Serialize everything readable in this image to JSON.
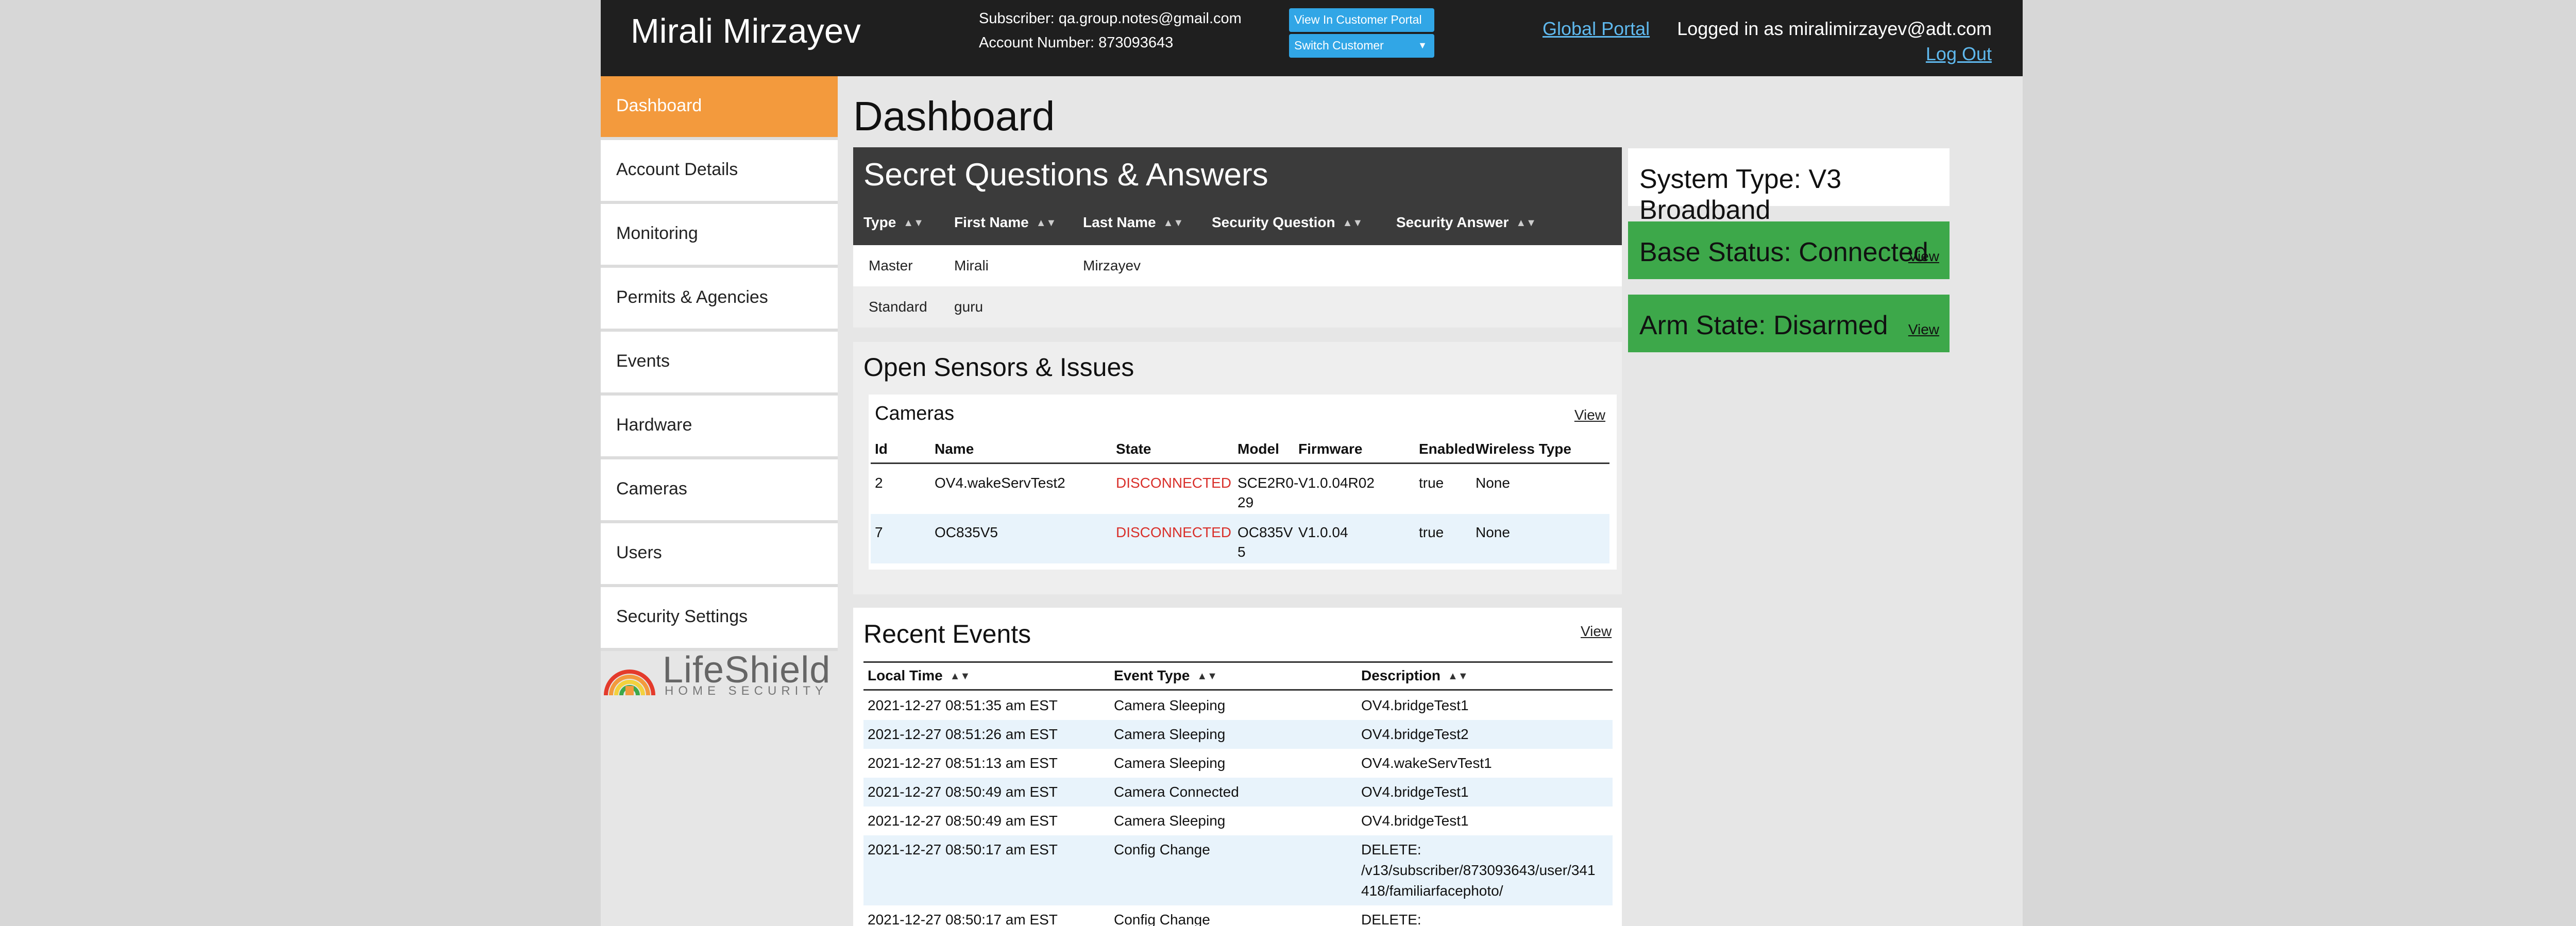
{
  "header": {
    "title": "Mirali Mirzayev",
    "subscriber": "Subscriber: qa.group.notes@gmail.com",
    "account": "Account Number: 873093643",
    "view_portal_btn": "View In Customer Portal",
    "switch_customer_btn": "Switch Customer",
    "global_portal": "Global Portal",
    "logged_in": "Logged in as miralimirzayev@adt.com",
    "logout": "Log Out"
  },
  "sidebar": {
    "items": [
      {
        "label": "Dashboard",
        "active": true
      },
      {
        "label": "Account Details"
      },
      {
        "label": "Monitoring"
      },
      {
        "label": "Permits & Agencies"
      },
      {
        "label": "Events"
      },
      {
        "label": "Hardware"
      },
      {
        "label": "Cameras"
      },
      {
        "label": "Users"
      },
      {
        "label": "Security Settings"
      }
    ],
    "logo_main": "LifeShield",
    "logo_sub": "HOME SECURITY"
  },
  "page": {
    "title": "Dashboard"
  },
  "secret_qa": {
    "title": "Secret Questions & Answers",
    "columns": [
      "Type",
      "First Name",
      "Last Name",
      "Security Question",
      "Security Answer"
    ],
    "rows": [
      [
        "Master",
        "Mirali",
        "Mirzayev",
        "",
        ""
      ],
      [
        "Standard",
        "guru",
        "",
        "",
        ""
      ]
    ]
  },
  "sensors": {
    "title": "Open Sensors & Issues",
    "cameras_title": "Cameras",
    "view": "View",
    "columns": [
      "Id",
      "Name",
      "State",
      "Model",
      "Firmware",
      "Enabled",
      "Wireless Type"
    ],
    "rows": [
      {
        "id": "2",
        "name": "OV4.wakeServTest2",
        "state": "DISCONNECTED",
        "model_1": "SCE2R0-",
        "model_2": "29",
        "firmware": "V1.0.04R02",
        "enabled": "true",
        "wireless": "None"
      },
      {
        "id": "7",
        "name": "OC835V5",
        "state": "DISCONNECTED",
        "model_1": "OC835V",
        "model_2": "5",
        "firmware": "V1.0.04",
        "enabled": "true",
        "wireless": "None"
      }
    ]
  },
  "events": {
    "title": "Recent Events",
    "view": "View",
    "columns": [
      "Local Time",
      "Event Type",
      "Description"
    ],
    "rows": [
      {
        "time": "2021-12-27 08:51:35 am EST",
        "type": "Camera Sleeping",
        "desc": "OV4.bridgeTest1"
      },
      {
        "time": "2021-12-27 08:51:26 am EST",
        "type": "Camera Sleeping",
        "desc": "OV4.bridgeTest2"
      },
      {
        "time": "2021-12-27 08:51:13 am EST",
        "type": "Camera Sleeping",
        "desc": "OV4.wakeServTest1"
      },
      {
        "time": "2021-12-27 08:50:49 am EST",
        "type": "Camera Connected",
        "desc": "OV4.bridgeTest1"
      },
      {
        "time": "2021-12-27 08:50:49 am EST",
        "type": "Camera Sleeping",
        "desc": "OV4.bridgeTest1"
      },
      {
        "time": "2021-12-27 08:50:17 am EST",
        "type": "Config Change",
        "desc_1": "DELETE:",
        "desc_2": "/v13/subscriber/873093643/user/341",
        "desc_3": "418/familiarfacephoto/"
      },
      {
        "time": "2021-12-27 08:50:17 am EST",
        "type": "Config Change",
        "desc": "DELETE:"
      }
    ]
  },
  "status": {
    "system_type": "System Type: V3 Broadband",
    "base_status": "Base Status: Connected",
    "arm_state": "Arm State: Disarmed",
    "view": "View"
  },
  "colors": {
    "accent_orange": "#f39a3d",
    "status_green": "#3da84a",
    "link_blue": "#5fb9ee",
    "alert_red": "#d9302b",
    "header_dark": "#1f1f1f"
  }
}
